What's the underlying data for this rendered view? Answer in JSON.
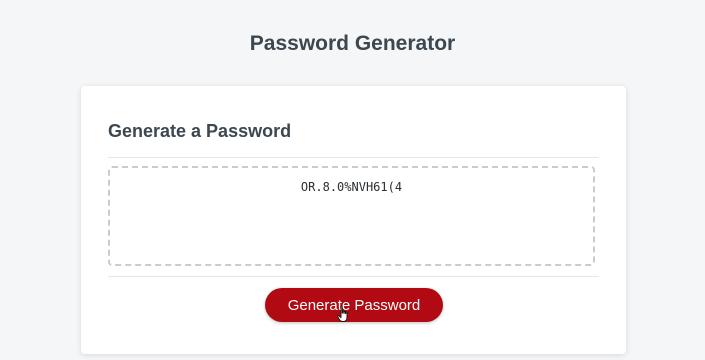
{
  "header": {
    "title": "Password Generator"
  },
  "card": {
    "title": "Generate a Password",
    "password_value": "OR.8.0%NVH61(4"
  },
  "actions": {
    "generate_label": "Generate Password"
  },
  "colors": {
    "accent": "#b10a12",
    "background": "#f5f6f7",
    "heading": "#3c4750"
  },
  "icons": {
    "cursor": "hand-pointer-icon"
  }
}
